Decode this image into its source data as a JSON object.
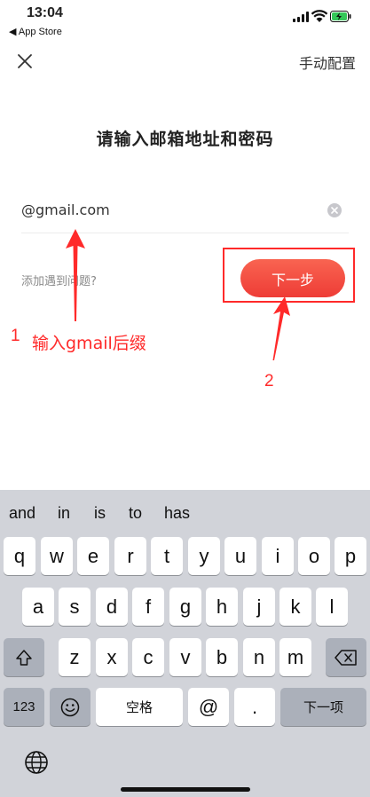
{
  "status_bar": {
    "time": "13:04",
    "back_app": "App Store"
  },
  "header": {
    "manual_config": "手动配置"
  },
  "title": "请输入邮箱地址和密码",
  "email": {
    "value": "@gmail.com"
  },
  "help_link": "添加遇到问题?",
  "next_button": "下一步",
  "annotations": {
    "step1_number": "1",
    "step1_text": "输入gmail后缀",
    "step2_number": "2",
    "color": "#ff2a2a"
  },
  "keyboard": {
    "suggestions": [
      "and",
      "in",
      "is",
      "to",
      "has"
    ],
    "row1": [
      "q",
      "w",
      "e",
      "r",
      "t",
      "y",
      "u",
      "i",
      "o",
      "p"
    ],
    "row2": [
      "a",
      "s",
      "d",
      "f",
      "g",
      "h",
      "j",
      "k",
      "l"
    ],
    "row3": [
      "z",
      "x",
      "c",
      "v",
      "b",
      "n",
      "m"
    ],
    "numbers_key": "123",
    "space_key": "空格",
    "at_key": "@",
    "dot_key": ".",
    "next_key": "下一项"
  },
  "colors": {
    "accent": "#ee3c36",
    "annotation": "#ff2a2a",
    "keyboard_bg": "#d1d3d9"
  }
}
